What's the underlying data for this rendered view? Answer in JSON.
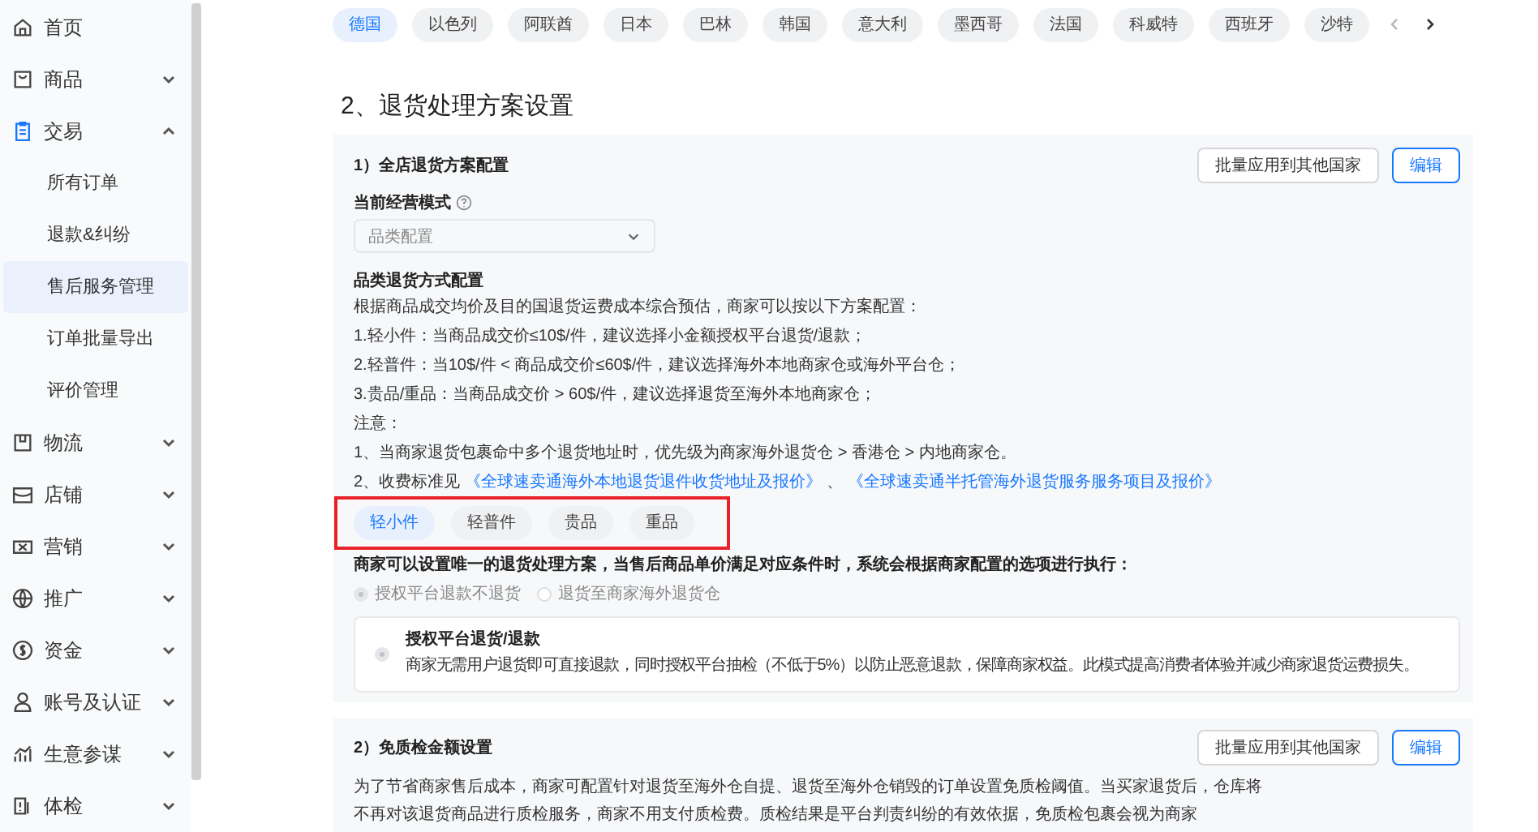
{
  "sidebar": {
    "items": [
      {
        "label": "首页",
        "active": false
      },
      {
        "label": "商品",
        "expanded": false,
        "active": false
      },
      {
        "label": "交易",
        "expanded": true,
        "active": true,
        "children": [
          {
            "label": "所有订单",
            "selected": false
          },
          {
            "label": "退款&纠纷",
            "selected": false
          },
          {
            "label": "售后服务管理",
            "selected": true
          },
          {
            "label": "订单批量导出",
            "selected": false
          },
          {
            "label": "评价管理",
            "selected": false
          }
        ]
      },
      {
        "label": "物流",
        "expanded": false,
        "active": false
      },
      {
        "label": "店铺",
        "expanded": false,
        "active": false
      },
      {
        "label": "营销",
        "expanded": false,
        "active": false
      },
      {
        "label": "推广",
        "expanded": false,
        "active": false
      },
      {
        "label": "资金",
        "expanded": false,
        "active": false
      },
      {
        "label": "账号及认证",
        "expanded": false,
        "active": false
      },
      {
        "label": "生意参谋",
        "expanded": false,
        "active": false
      },
      {
        "label": "体检",
        "expanded": false,
        "active": false
      }
    ]
  },
  "country_tabs": [
    {
      "label": "德国",
      "selected": true
    },
    {
      "label": "以色列",
      "selected": false
    },
    {
      "label": "阿联酋",
      "selected": false
    },
    {
      "label": "日本",
      "selected": false
    },
    {
      "label": "巴林",
      "selected": false
    },
    {
      "label": "韩国",
      "selected": false
    },
    {
      "label": "意大利",
      "selected": false
    },
    {
      "label": "墨西哥",
      "selected": false
    },
    {
      "label": "法国",
      "selected": false
    },
    {
      "label": "科威特",
      "selected": false
    },
    {
      "label": "西班牙",
      "selected": false
    },
    {
      "label": "沙特",
      "selected": false
    }
  ],
  "section_title": "2、退货处理方案设置",
  "store_plan": {
    "title": "1）全店退货方案配置",
    "buttons": [
      "批量应用到其他国家",
      "编辑"
    ],
    "mode_label": "当前经营模式",
    "mode_select": {
      "value": "品类配置"
    },
    "config_title": "品类退货方式配置",
    "lines": [
      "根据商品成交均价及目的国退货运费成本综合预估，商家可以按以下方案配置：",
      "1.轻小件：当商品成交价≤10$/件，建议选择小金额授权平台退货/退款；",
      "2.轻普件：当10$/件 < 商品成交价≤60$/件，建议选择海外本地商家仓或海外平台仓；",
      "3.贵品/重品：当商品成交价 > 60$/件，建议选择退货至海外本地商家仓；",
      "注意：",
      "1、当商家退货包裹命中多个退货地址时，优先级为商家海外退货仓 > 香港仓 > 内地商家仓。"
    ],
    "fee_prefix": "2、收费标准见",
    "fee_links": [
      "《全球速卖通海外本地退货退件收货地址及报价》",
      "《全球速卖通半托管海外退货服务服务项目及报价》"
    ],
    "fee_separator": "、",
    "category_tabs": [
      {
        "label": "轻小件",
        "selected": true
      },
      {
        "label": "轻普件",
        "selected": false
      },
      {
        "label": "贵品",
        "selected": false
      },
      {
        "label": "重品",
        "selected": false
      }
    ],
    "rule_text": "商家可以设置唯一的退货处理方案，当售后商品单价满足对应条件时，系统会根据商家配置的选项进行执行：",
    "radios": [
      {
        "label": "授权平台退款不退货",
        "selected": true,
        "disabled": true
      },
      {
        "label": "退货至商家海外退货仓",
        "selected": false,
        "disabled": true
      }
    ],
    "option_card": {
      "title": "授权平台退货/退款",
      "description": "商家无需用户退货即可直接退款，同时授权平台抽检（不低于5%）以防止恶意退款，保障商家权益。此模式提高消费者体验并减少商家退货运费损失。",
      "selected": true
    }
  },
  "inspection": {
    "title": "2）免质检金额设置",
    "buttons": [
      "批量应用到其他国家",
      "编辑"
    ],
    "description": "为了节省商家售后成本，商家可配置针对退货至海外仓自提、退货至海外仓销毁的订单设置免质检阈值。当买家退货后，仓库将不再对该退货商品进行质检服务，商家不用支付质检费。质检结果是平台判责纠纷的有效依据，免质检包裹会视为商家"
  }
}
